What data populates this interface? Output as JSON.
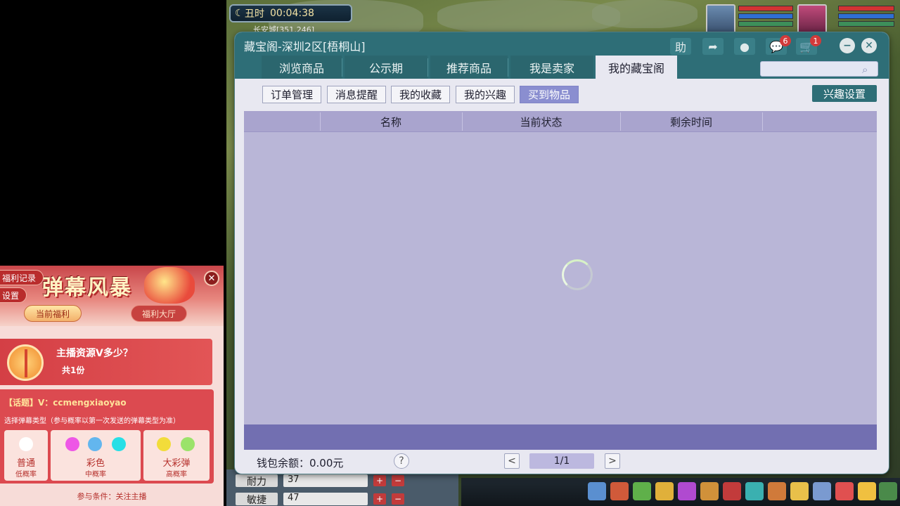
{
  "game": {
    "time_label": "丑时",
    "clock": "00:04:38",
    "location": "长安城[351,246]",
    "stats": [
      {
        "label": "耐力",
        "value": "37"
      },
      {
        "label": "敏捷",
        "value": "47"
      }
    ]
  },
  "window": {
    "title": "藏宝阁-深圳2区[梧桐山]",
    "help_label": "助",
    "messages_badge": "6",
    "cart_badge": "1",
    "tabs": [
      "浏览商品",
      "公示期",
      "推荐商品",
      "我是卖家",
      "我的藏宝阁"
    ],
    "active_tab": "我的藏宝阁",
    "search_placeholder": "",
    "subtabs": [
      "订单管理",
      "消息提醒",
      "我的收藏",
      "我的兴趣",
      "买到物品"
    ],
    "active_subtab": "买到物品",
    "interest_button": "兴趣设置",
    "columns": [
      "名称",
      "当前状态",
      "剩余时间"
    ],
    "rows": [],
    "wallet": "钱包余额：0.00元",
    "help_icon": "?",
    "page_indicator": "1/1",
    "colors": {
      "titlebar": "#2e6e77",
      "table": "#b9b6d7",
      "table_footer": "#726fb1"
    }
  },
  "panel": {
    "logo": "弹幕风暴",
    "side_items": [
      "福利记录",
      "设置"
    ],
    "tabs": [
      "当前福利",
      "福利大厅"
    ],
    "gift_title": "主播资源V多少？",
    "gift_count": "共1份",
    "topic": "【话题】V：ccmengxiaoyao",
    "hint": "选择弹幕类型（参与概率以第一次发送的弹幕类型为准）",
    "types": [
      {
        "name": "普通",
        "rate": "低概率"
      },
      {
        "name": "彩色",
        "rate": "中概率"
      },
      {
        "name": "大彩弹",
        "rate": "高概率"
      }
    ],
    "condition": "参与条件：关注主播"
  }
}
